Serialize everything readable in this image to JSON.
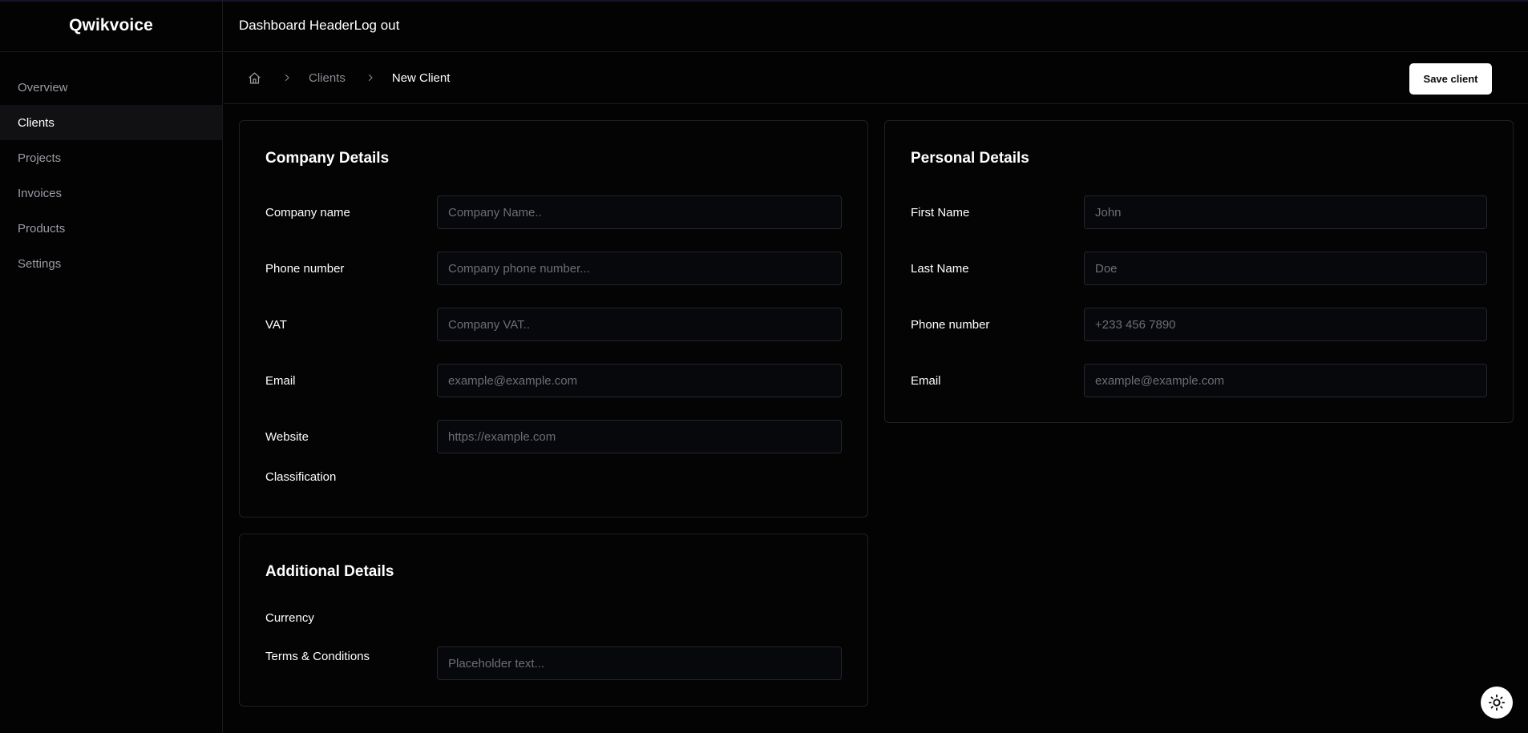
{
  "app": {
    "brand": "Qwikvoice"
  },
  "sidebar": {
    "items": [
      {
        "label": "Overview"
      },
      {
        "label": "Clients"
      },
      {
        "label": "Projects"
      },
      {
        "label": "Invoices"
      },
      {
        "label": "Products"
      },
      {
        "label": "Settings"
      }
    ],
    "active": "Clients"
  },
  "header": {
    "title": "Dashboard HeaderLog out"
  },
  "breadcrumb": {
    "home_icon": "home-icon",
    "separator_icon": "chevron-right-icon",
    "parent": "Clients",
    "current": "New Client"
  },
  "toolbar": {
    "save_label": "Save client"
  },
  "company": {
    "title": "Company Details",
    "fields": [
      {
        "label": "Company name",
        "value": "",
        "placeholder": "Company Name.."
      },
      {
        "label": "Phone number",
        "value": "",
        "placeholder": "Company phone number..."
      },
      {
        "label": "VAT",
        "value": "",
        "placeholder": "Company VAT.."
      },
      {
        "label": "Email",
        "value": "",
        "placeholder": "example@example.com"
      },
      {
        "label": "Website",
        "value": "",
        "placeholder": "https://example.com"
      }
    ],
    "classification_label": "Classification"
  },
  "personal": {
    "title": "Personal Details",
    "fields": [
      {
        "label": "First Name",
        "value": "",
        "placeholder": "John"
      },
      {
        "label": "Last Name",
        "value": "",
        "placeholder": "Doe"
      },
      {
        "label": "Phone number",
        "value": "",
        "placeholder": "+233 456 7890"
      },
      {
        "label": "Email",
        "value": "",
        "placeholder": "example@example.com"
      }
    ]
  },
  "additional": {
    "title": "Additional Details",
    "currency_label": "Currency",
    "terms": {
      "label": "Terms & Conditions",
      "value": "",
      "placeholder": "Placeholder text..."
    }
  },
  "theme_toggle": {
    "icon": "sun-icon"
  },
  "colors": {
    "background": "#030304",
    "border": "#202024",
    "accent": "#ffffff",
    "muted_text": "#9b9ba3"
  }
}
